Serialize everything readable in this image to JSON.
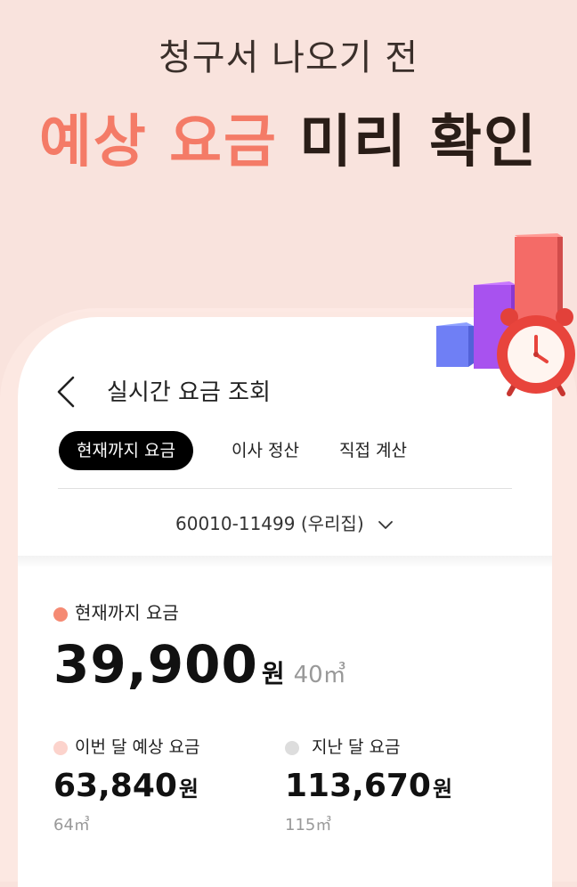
{
  "headline": {
    "line1": "청구서 나오기 전",
    "accent": "예상 요금",
    "rest": "미리 확인"
  },
  "screen": {
    "title": "실시간 요금 조회",
    "tabs": [
      {
        "label": "현재까지 요금",
        "active": true
      },
      {
        "label": "이사 정산",
        "active": false
      },
      {
        "label": "직접 계산",
        "active": false
      }
    ],
    "account": "60010-11499 (우리집)"
  },
  "current": {
    "label": "현재까지 요금",
    "amount": "39,900",
    "unit": "원",
    "usage": "40㎥",
    "dot_color": "#f58a73"
  },
  "forecast": {
    "label": "이번 달 예상 요금",
    "amount": "63,840",
    "unit": "원",
    "usage": "64㎥",
    "dot_color": "#fcd3cc"
  },
  "last_month": {
    "label": "지난 달 요금",
    "amount": "113,670",
    "unit": "원",
    "usage": "115㎥",
    "dot_color": "#dddddd"
  },
  "colors": {
    "accent": "#f47b67",
    "background": "#f9e3dd"
  },
  "icons": {
    "back": "chevron-left-icon",
    "dropdown": "chevron-down-icon",
    "decoration": "bar-chart-alarm-clock-icon"
  }
}
